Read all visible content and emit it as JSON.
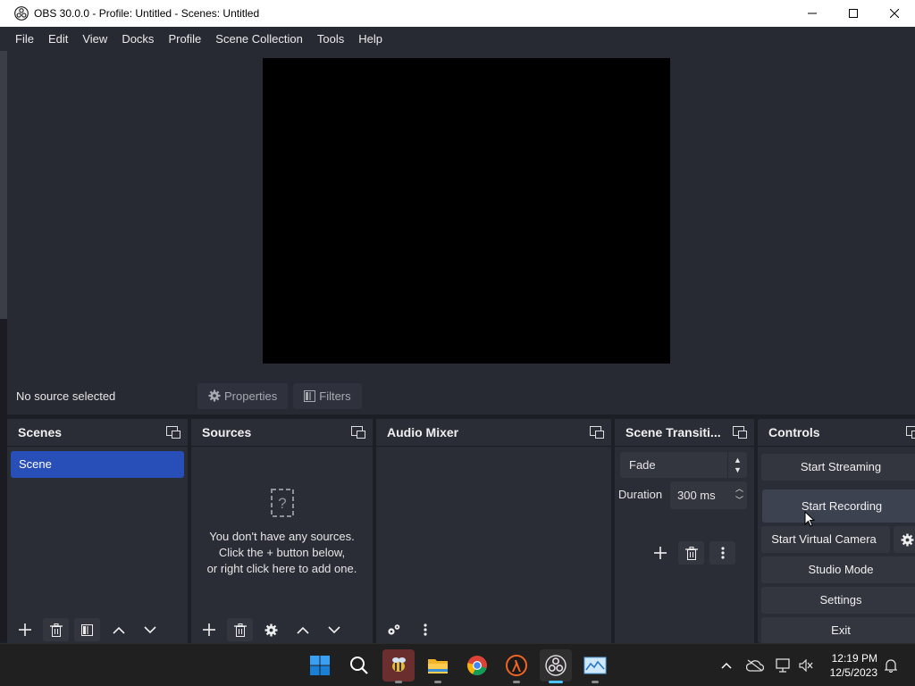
{
  "window": {
    "title": "OBS 30.0.0 - Profile: Untitled - Scenes: Untitled"
  },
  "menu": [
    "File",
    "Edit",
    "View",
    "Docks",
    "Profile",
    "Scene Collection",
    "Tools",
    "Help"
  ],
  "source_bar": {
    "status": "No source selected",
    "properties_label": "Properties",
    "filters_label": "Filters"
  },
  "scenes": {
    "title": "Scenes",
    "items": [
      "Scene"
    ]
  },
  "sources": {
    "title": "Sources",
    "empty_line1": "You don't have any sources.",
    "empty_line2": "Click the + button below,",
    "empty_line3": "or right click here to add one."
  },
  "audio_mixer": {
    "title": "Audio Mixer"
  },
  "transitions": {
    "title": "Scene Transiti...",
    "selected": "Fade",
    "duration_label": "Duration",
    "duration_value": "300 ms"
  },
  "controls": {
    "title": "Controls",
    "start_streaming": "Start Streaming",
    "start_recording": "Start Recording",
    "start_virtual_camera": "Start Virtual Camera",
    "studio_mode": "Studio Mode",
    "settings": "Settings",
    "exit": "Exit"
  },
  "taskbar": {
    "time": "12:19 PM",
    "date": "12/5/2023",
    "apps": [
      "start-icon",
      "search-icon",
      "bee-app-icon",
      "file-explorer-icon",
      "chrome-icon",
      "half-life-icon",
      "obs-icon",
      "photos-icon"
    ]
  },
  "colors": {
    "accent_scene": "#284fb8",
    "dock_bg": "#2a2d36",
    "taskbar_active": "#4cc2ff"
  }
}
